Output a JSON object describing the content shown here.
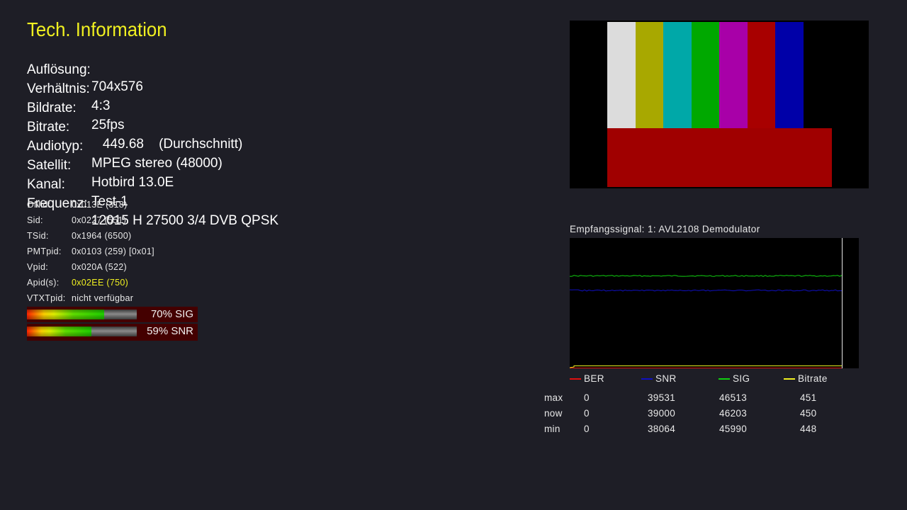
{
  "title": "Tech. Information",
  "info": [
    {
      "label": "Auflösung:",
      "value": "704x576"
    },
    {
      "label": "Verhältnis:",
      "value": "4:3"
    },
    {
      "label": "Bildrate:",
      "value": "25fps"
    },
    {
      "label": "Bitrate:",
      "value": "   449.68    (Durchschnitt)"
    },
    {
      "label": "Audiotyp:",
      "value": "MPEG stereo (48000)"
    },
    {
      "label": "Satellit:",
      "value": "Hotbird 13.0E"
    },
    {
      "label": "Kanal:",
      "value": "Test-1"
    },
    {
      "label": "Frequenz:",
      "value": "12015 H 27500 3/4 DVB QPSK"
    }
  ],
  "pids": [
    {
      "label": "ONid:",
      "value": "0x013E (318)"
    },
    {
      "label": "Sid:",
      "value": "0x0227 (551)"
    },
    {
      "label": "TSid:",
      "value": "0x1964 (6500)"
    },
    {
      "label": "PMTpid:",
      "value": "0x0103 (259) [0x01]"
    },
    {
      "label": "Vpid:",
      "value": "0x020A (522)"
    },
    {
      "label": "Apid(s):",
      "value": "0x02EE (750)"
    },
    {
      "label": "VTXTpid:",
      "value": "nicht verfügbar"
    }
  ],
  "meters": {
    "sig": {
      "percent": 70,
      "text": "70% SIG"
    },
    "snr": {
      "percent": 59,
      "text": "59% SNR"
    }
  },
  "preview": {
    "bar_colors": [
      "#dcdcdc",
      "#a8a800",
      "#00a8a8",
      "#00a800",
      "#a800a8",
      "#a80000",
      "#0000a8",
      "#000000"
    ],
    "bottom_color": "#a00000"
  },
  "graph": {
    "title": "Empfangssignal: 1: AVL2108 Demodulator",
    "colors": {
      "BER": "#e01010",
      "SNR": "#1010c0",
      "SIG": "#10d010",
      "Bitrate": "#f0f020"
    }
  },
  "legend": [
    {
      "name": "BER",
      "color": "#e01010"
    },
    {
      "name": "SNR",
      "color": "#1010c0"
    },
    {
      "name": "SIG",
      "color": "#10d010"
    },
    {
      "name": "Bitrate",
      "color": "#f0f020"
    }
  ],
  "stats": {
    "rows": [
      {
        "label": "max",
        "values": [
          "0",
          "39531",
          "46513",
          "451"
        ]
      },
      {
        "label": "now",
        "values": [
          "0",
          "39000",
          "46203",
          "450"
        ]
      },
      {
        "label": "min",
        "values": [
          "0",
          "38064",
          "45990",
          "448"
        ]
      }
    ]
  }
}
